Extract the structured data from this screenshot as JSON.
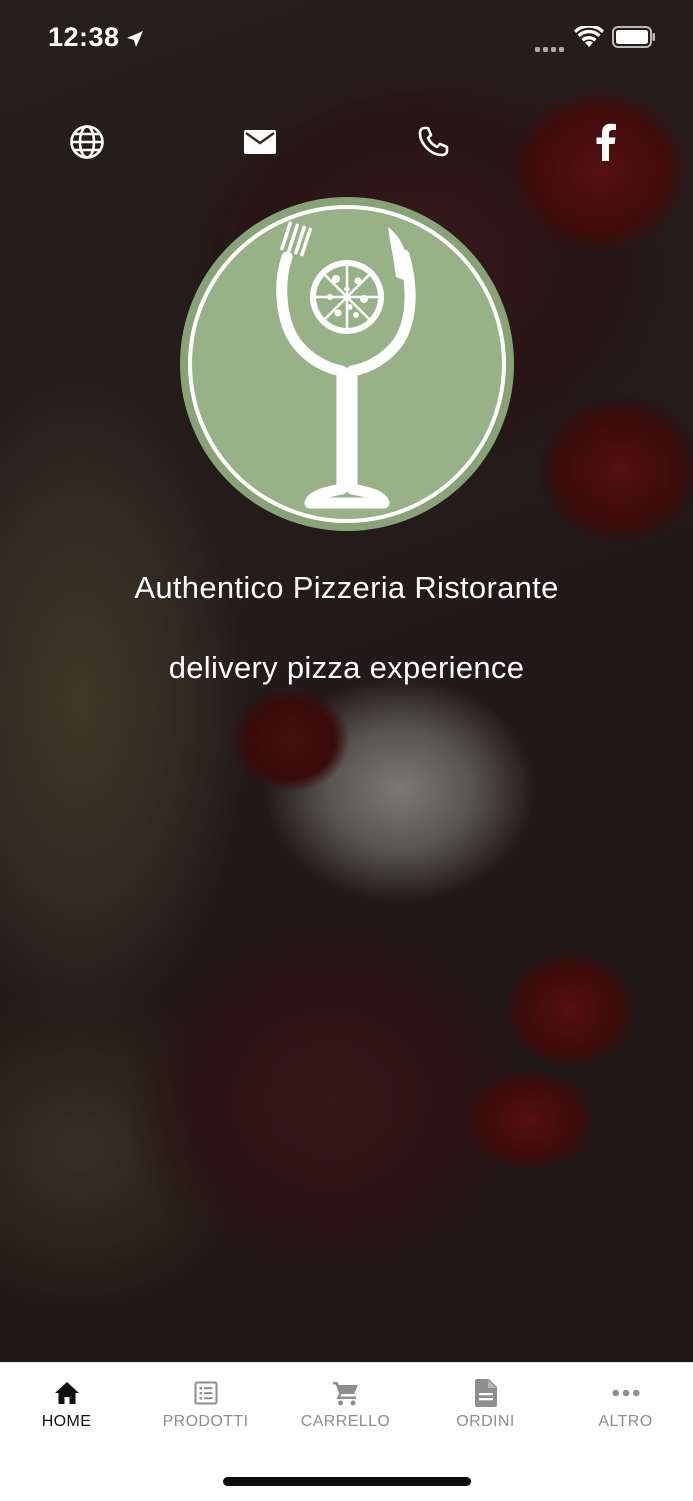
{
  "status_bar": {
    "time": "12:38",
    "icons": [
      "location-arrow-icon",
      "signal-icon",
      "wifi-icon",
      "battery-icon"
    ]
  },
  "top_icons": [
    "globe-icon",
    "mail-icon",
    "phone-icon",
    "facebook-icon"
  ],
  "logo": {
    "icons": [
      "wine-glass-icon",
      "fork-icon",
      "knife-icon",
      "pizza-icon"
    ]
  },
  "restaurant": {
    "name": "Authentico Pizzeria Ristorante",
    "tagline": "delivery pizza experience"
  },
  "tabs": [
    {
      "label": "HOME",
      "icon": "home-icon",
      "active": true
    },
    {
      "label": "PRODOTTI",
      "icon": "list-icon",
      "active": false
    },
    {
      "label": "CARRELLO",
      "icon": "cart-icon",
      "active": false
    },
    {
      "label": "ORDINI",
      "icon": "document-icon",
      "active": false
    },
    {
      "label": "ALTRO",
      "icon": "more-icon",
      "active": false
    }
  ],
  "colors": {
    "logo_green": "#98b287",
    "logo_ring": "#87a477",
    "tab_active": "#111111",
    "tab_inactive": "#8e8e8e"
  }
}
